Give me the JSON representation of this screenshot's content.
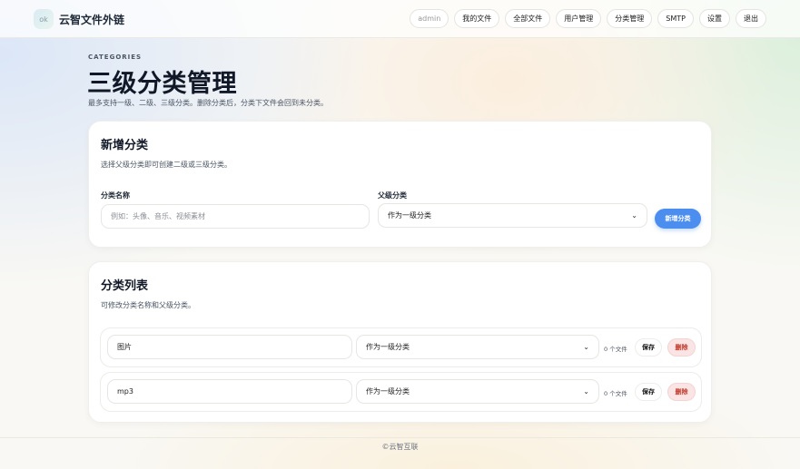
{
  "header": {
    "logo_text": "ok",
    "brand": "云智文件外链",
    "nav": [
      {
        "label": "admin"
      },
      {
        "label": "我的文件"
      },
      {
        "label": "全部文件"
      },
      {
        "label": "用户管理"
      },
      {
        "label": "分类管理"
      },
      {
        "label": "SMTP"
      },
      {
        "label": "设置"
      },
      {
        "label": "退出"
      }
    ]
  },
  "page": {
    "eyebrow": "CATEGORIES",
    "title": "三级分类管理",
    "description": "最多支持一级、二级、三级分类。删除分类后，分类下文件会回到未分类。"
  },
  "create": {
    "title": "新增分类",
    "subtitle": "选择父级分类即可创建二级或三级分类。",
    "name_label": "分类名称",
    "name_placeholder": "例如：头像、音乐、视频素材",
    "parent_label": "父级分类",
    "parent_value": "作为一级分类",
    "submit_label": "新增分类"
  },
  "list": {
    "title": "分类列表",
    "subtitle": "可修改分类名称和父级分类。",
    "rows": [
      {
        "name": "图片",
        "parent": "作为一级分类",
        "count": "0 个文件",
        "save": "保存",
        "delete": "删除"
      },
      {
        "name": "mp3",
        "parent": "作为一级分类",
        "count": "0 个文件",
        "save": "保存",
        "delete": "删除"
      }
    ]
  },
  "footer": {
    "text": "©云智互联"
  },
  "colors": {
    "primary": "#4b8ef0",
    "danger": "#c0392b",
    "danger_bg": "#fbe4e4"
  }
}
